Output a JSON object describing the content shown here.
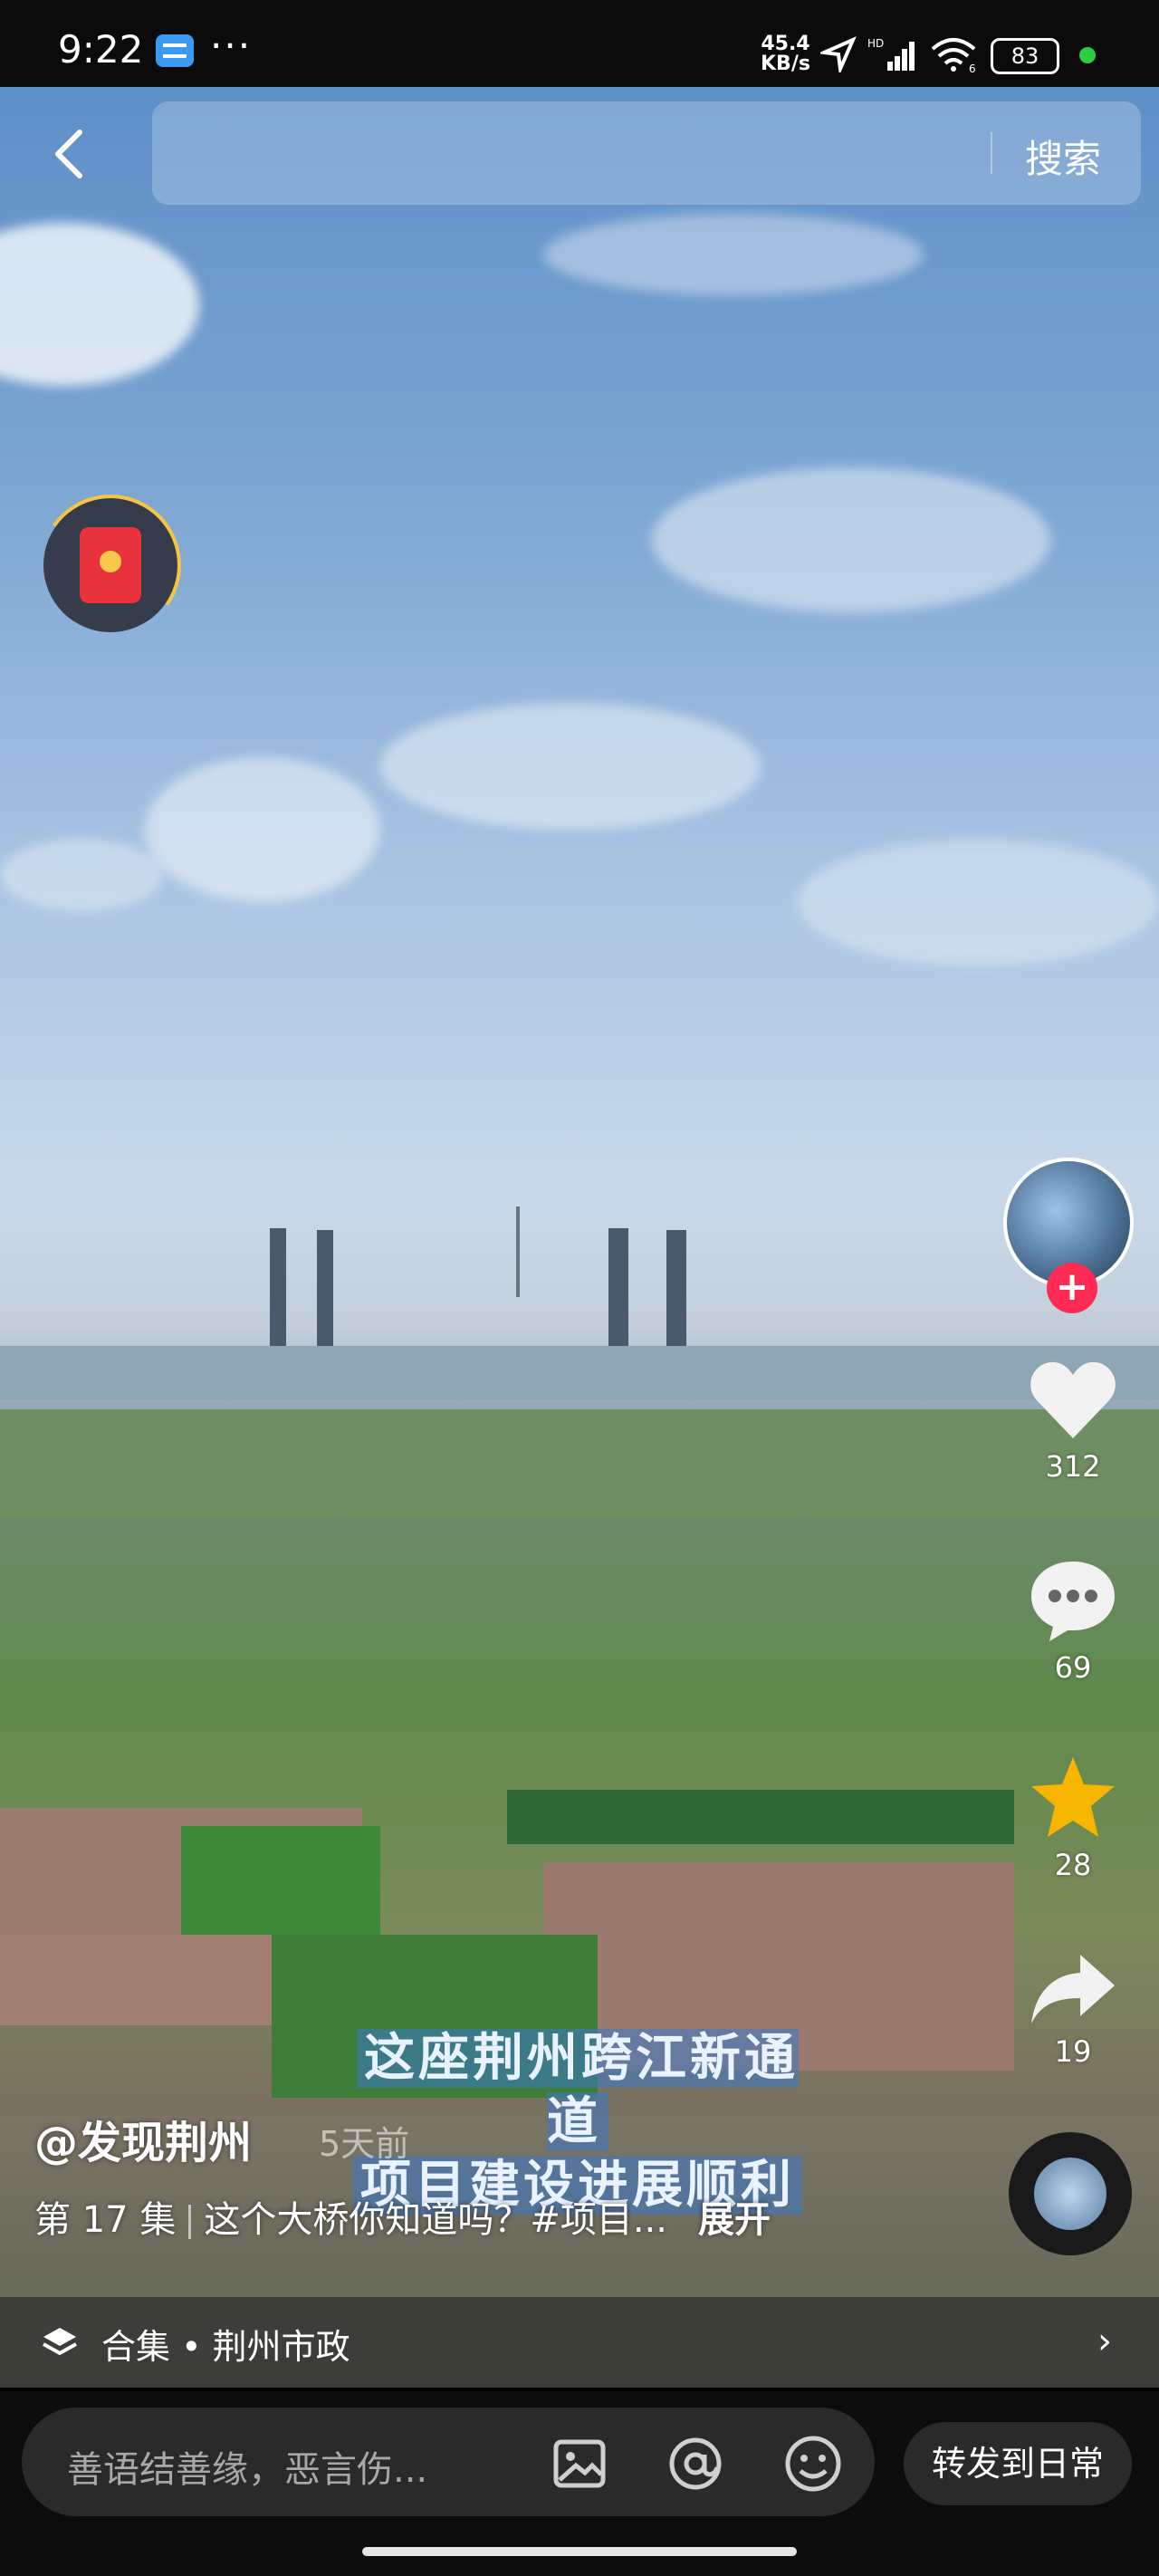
{
  "status": {
    "time": "9:22",
    "dots": "···",
    "net_speed": "45.4",
    "net_unit": "KB/s",
    "battery": "83",
    "hd": "HD",
    "wifi_badge": "6"
  },
  "header": {
    "search_button": "搜索"
  },
  "actions": {
    "likes": "312",
    "comments": "69",
    "favorites": "28",
    "shares": "19"
  },
  "caption": {
    "line1": "这座荆州跨江新通道",
    "line2": "项目建设进展顺利"
  },
  "post": {
    "author": "@发现荆州",
    "time_ago": "5天前",
    "episode": "第 17 集",
    "description": "这个大桥你知道吗？#项目...",
    "expand": "展开"
  },
  "collection": {
    "label": "合集 • 荆州市政"
  },
  "bottom": {
    "comment_placeholder": "善语结善缘，恶言伤...",
    "forward_button": "转发到日常"
  },
  "colors": {
    "accent_red": "#fe2c55",
    "star_yellow": "#f7b500"
  }
}
